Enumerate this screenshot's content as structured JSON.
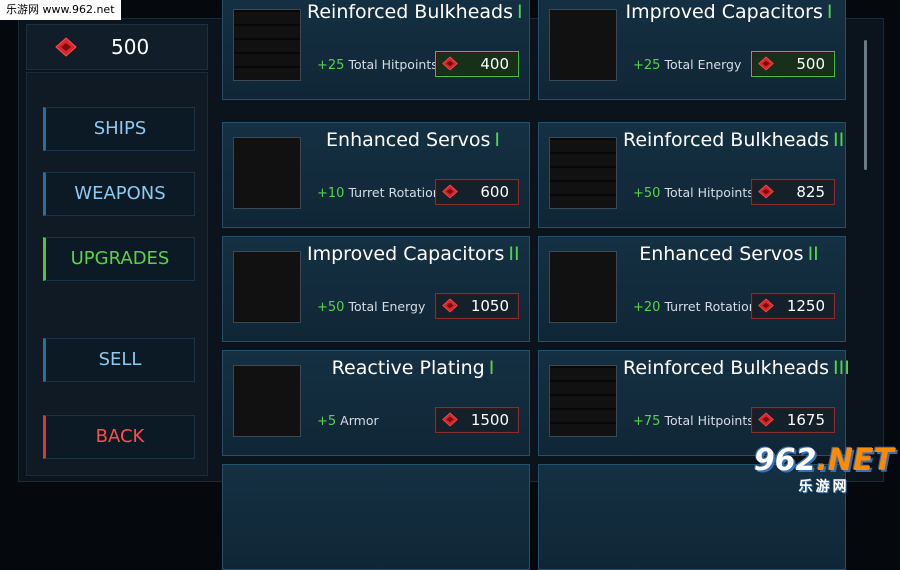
{
  "watermark": {
    "top_text": "乐游网 www.962.net",
    "logo_main": "962",
    "logo_suffix": ".NET",
    "logo_sub": "乐游网"
  },
  "currency": {
    "icon": "gem-icon",
    "amount": "500"
  },
  "menu": {
    "ships": "SHIPS",
    "weapons": "WEAPONS",
    "upgrades": "UPGRADES",
    "sell": "SELL",
    "back": "BACK"
  },
  "colors": {
    "accent_green": "#55d24a",
    "accent_blue": "#8ec9ee",
    "accent_red": "#ff4d4d",
    "card_bg": "#143042"
  },
  "upgrades": [
    {
      "title": "Reinforced Bulkheads",
      "tier": "I",
      "stat_value": "+25",
      "stat_label": "Total Hitpoints",
      "price": "400",
      "image": "bulkhead-image",
      "affordable": true
    },
    {
      "title": "Improved Capacitors",
      "tier": "I",
      "stat_value": "+25",
      "stat_label": "Total Energy",
      "price": "500",
      "image": "capacitor-image",
      "affordable": true
    },
    {
      "title": "Enhanced Servos",
      "tier": "I",
      "stat_value": "+10",
      "stat_label": "Turret Rotation",
      "price": "600",
      "image": "servo-image",
      "affordable": false
    },
    {
      "title": "Reinforced Bulkheads",
      "tier": "II",
      "stat_value": "+50",
      "stat_label": "Total Hitpoints",
      "price": "825",
      "image": "bulkhead-image",
      "affordable": false
    },
    {
      "title": "Improved Capacitors",
      "tier": "II",
      "stat_value": "+50",
      "stat_label": "Total Energy",
      "price": "1050",
      "image": "capacitor-image",
      "affordable": false
    },
    {
      "title": "Enhanced Servos",
      "tier": "II",
      "stat_value": "+20",
      "stat_label": "Turret Rotation",
      "price": "1250",
      "image": "servo-image",
      "affordable": false
    },
    {
      "title": "Reactive Plating",
      "tier": "I",
      "stat_value": "+5",
      "stat_label": "Armor",
      "price": "1500",
      "image": "plating-image",
      "affordable": false
    },
    {
      "title": "Reinforced Bulkheads",
      "tier": "III",
      "stat_value": "+75",
      "stat_label": "Total Hitpoints",
      "price": "1675",
      "image": "bulkhead-image",
      "affordable": false
    }
  ]
}
